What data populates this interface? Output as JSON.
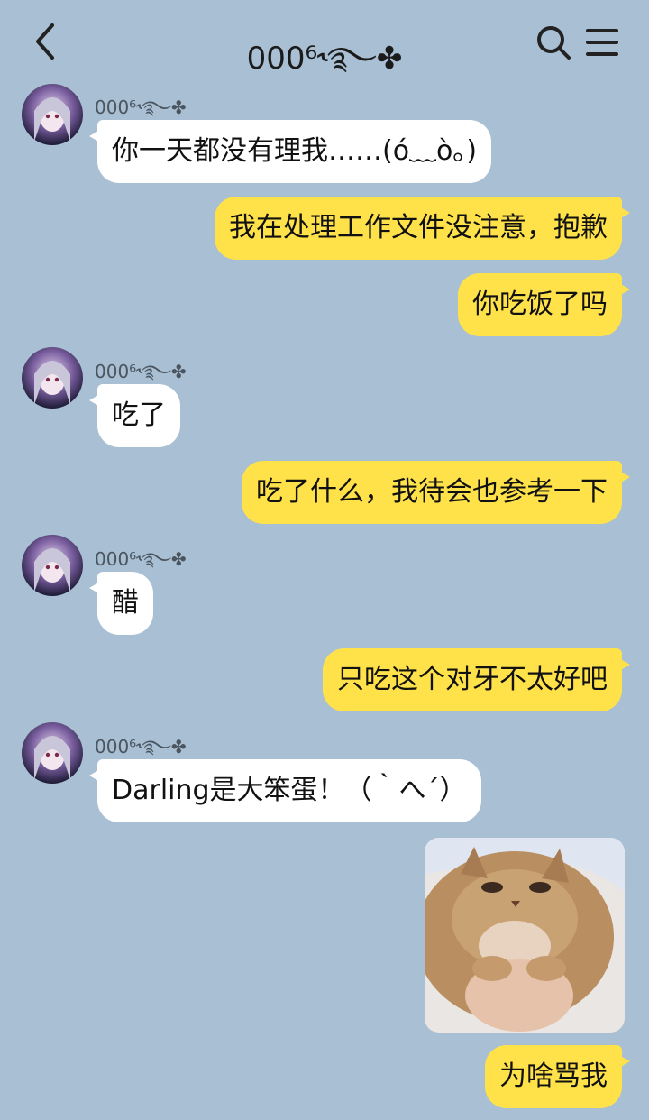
{
  "header": {
    "title": "000⁶˞࿐✤"
  },
  "contact_name": "000⁶˞࿐✤",
  "messages": [
    {
      "side": "in",
      "text": "你一天都没有理我……(ó﹏ò｡)"
    },
    {
      "side": "out",
      "text": "我在处理工作文件没注意，抱歉"
    },
    {
      "side": "out",
      "text": "你吃饭了吗"
    },
    {
      "side": "in",
      "text": "吃了"
    },
    {
      "side": "out",
      "text": "吃了什么，我待会也参考一下"
    },
    {
      "side": "in",
      "text": "醋"
    },
    {
      "side": "out",
      "text": "只吃这个对牙不太好吧"
    },
    {
      "side": "in",
      "text": "Darling是大笨蛋！（｀へ´）"
    },
    {
      "side": "out",
      "type": "image",
      "image_desc": "cat-sticker"
    },
    {
      "side": "out",
      "text": "为啥骂我"
    }
  ],
  "colors": {
    "background": "#a9bfd3",
    "outgoing_bubble": "#ffe24a",
    "incoming_bubble": "#ffffff"
  },
  "icons": {
    "back": "chevron-left-icon",
    "search": "search-icon",
    "menu": "hamburger-menu-icon"
  }
}
